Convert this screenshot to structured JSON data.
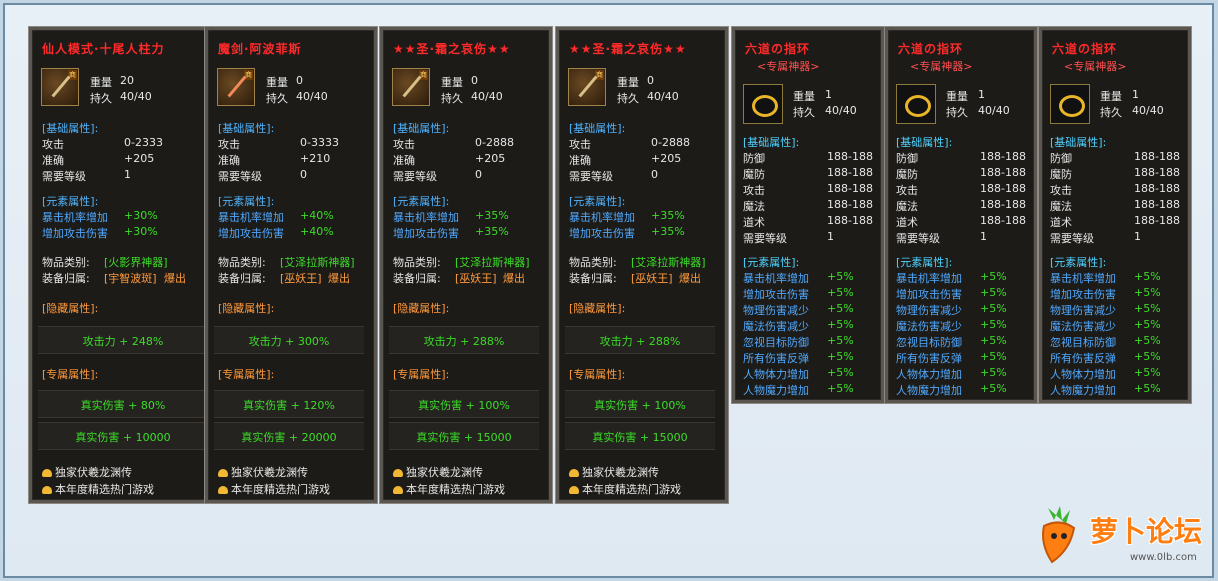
{
  "cards": [
    {
      "title": "仙人模式·十尾人柱力",
      "weight_label": "重量",
      "weight": "20",
      "dur_label": "持久",
      "dur": "40/40",
      "base_header": "[基础属性]:",
      "base": [
        [
          "攻击",
          "0-2333"
        ],
        [
          "准确",
          "+205"
        ],
        [
          "需要等级",
          "1"
        ]
      ],
      "elem_header": "[元素属性]:",
      "elem": [
        [
          "暴击机率增加",
          "+30%"
        ],
        [
          "增加攻击伤害",
          "+30%"
        ]
      ],
      "cat_label": "物品类别:",
      "cat_value": "[火影界神器]",
      "owner_label": "装备归属:",
      "owner_value": "[宇智波斑]",
      "owner_suffix": "爆出",
      "hidden_header": "[隐藏属性]:",
      "hidden": "攻击力 + 248%",
      "excl_header": "[专属属性]:",
      "excl": [
        "真实伤害 + 80%",
        "真实伤害 + 10000"
      ],
      "promo": [
        "独家伏羲龙渊传",
        "本年度精选热门游戏"
      ]
    },
    {
      "title": "魔剑·阿波菲斯",
      "weight_label": "重量",
      "weight": "0",
      "dur_label": "持久",
      "dur": "40/40",
      "base_header": "[基础属性]:",
      "base": [
        [
          "攻击",
          "0-3333"
        ],
        [
          "准确",
          "+210"
        ],
        [
          "需要等级",
          "0"
        ]
      ],
      "elem_header": "[元素属性]:",
      "elem": [
        [
          "暴击机率增加",
          "+40%"
        ],
        [
          "增加攻击伤害",
          "+40%"
        ]
      ],
      "cat_label": "物品类别:",
      "cat_value": "[艾泽拉斯神器]",
      "owner_label": "装备归属:",
      "owner_value": "[巫妖王]",
      "owner_suffix": "爆出",
      "hidden_header": "[隐藏属性]:",
      "hidden": "攻击力 + 300%",
      "excl_header": "[专属属性]:",
      "excl": [
        "真实伤害 + 120%",
        "真实伤害 + 20000"
      ],
      "promo": [
        "独家伏羲龙渊传",
        "本年度精选热门游戏"
      ]
    },
    {
      "title": "★★圣·霜之哀伤★★",
      "weight_label": "重量",
      "weight": "0",
      "dur_label": "持久",
      "dur": "40/40",
      "base_header": "[基础属性]:",
      "base": [
        [
          "攻击",
          "0-2888"
        ],
        [
          "准确",
          "+205"
        ],
        [
          "需要等级",
          "0"
        ]
      ],
      "elem_header": "[元素属性]:",
      "elem": [
        [
          "暴击机率增加",
          "+35%"
        ],
        [
          "增加攻击伤害",
          "+35%"
        ]
      ],
      "cat_label": "物品类别:",
      "cat_value": "[艾泽拉斯神器]",
      "owner_label": "装备归属:",
      "owner_value": "[巫妖王]",
      "owner_suffix": "爆出",
      "hidden_header": "[隐藏属性]:",
      "hidden": "攻击力 + 288%",
      "excl_header": "[专属属性]:",
      "excl": [
        "真实伤害 + 100%",
        "真实伤害 + 15000"
      ],
      "promo": [
        "独家伏羲龙渊传",
        "本年度精选热门游戏"
      ]
    },
    {
      "title": "★★圣·霜之哀伤★★",
      "weight_label": "重量",
      "weight": "0",
      "dur_label": "持久",
      "dur": "40/40",
      "base_header": "[基础属性]:",
      "base": [
        [
          "攻击",
          "0-2888"
        ],
        [
          "准确",
          "+205"
        ],
        [
          "需要等级",
          "0"
        ]
      ],
      "elem_header": "[元素属性]:",
      "elem": [
        [
          "暴击机率增加",
          "+35%"
        ],
        [
          "增加攻击伤害",
          "+35%"
        ]
      ],
      "cat_label": "物品类别:",
      "cat_value": "[艾泽拉斯神器]",
      "owner_label": "装备归属:",
      "owner_value": "[巫妖王]",
      "owner_suffix": "爆出",
      "hidden_header": "[隐藏属性]:",
      "hidden": "攻击力 + 288%",
      "excl_header": "[专属属性]:",
      "excl": [
        "真实伤害 + 100%",
        "真实伤害 + 15000"
      ],
      "promo": [
        "独家伏羲龙渊传",
        "本年度精选热门游戏"
      ]
    }
  ],
  "rings": [
    {
      "title": "六道の指环",
      "subtitle": "<专属神器>",
      "weight_label": "重量",
      "weight": "1",
      "dur_label": "持久",
      "dur": "40/40",
      "base_header": "[基础属性]:",
      "base": [
        [
          "防御",
          "188-188"
        ],
        [
          "魔防",
          "188-188"
        ],
        [
          "攻击",
          "188-188"
        ],
        [
          "魔法",
          "188-188"
        ],
        [
          "道术",
          "188-188"
        ],
        [
          "需要等级",
          "1"
        ]
      ],
      "elem_header": "[元素属性]:",
      "elem": [
        [
          "暴击机率增加",
          "+5%"
        ],
        [
          "增加攻击伤害",
          "+5%"
        ],
        [
          "物理伤害减少",
          "+5%"
        ],
        [
          "魔法伤害减少",
          "+5%"
        ],
        [
          "忽视目标防御",
          "+5%"
        ],
        [
          "所有伤害反弹",
          "+5%"
        ],
        [
          "人物体力增加",
          "+5%"
        ],
        [
          "人物魔力增加",
          "+5%"
        ]
      ]
    },
    {
      "title": "六道の指环",
      "subtitle": "<专属神器>",
      "weight_label": "重量",
      "weight": "1",
      "dur_label": "持久",
      "dur": "40/40",
      "base_header": "[基础属性]:",
      "base": [
        [
          "防御",
          "188-188"
        ],
        [
          "魔防",
          "188-188"
        ],
        [
          "攻击",
          "188-188"
        ],
        [
          "魔法",
          "188-188"
        ],
        [
          "道术",
          "188-188"
        ],
        [
          "需要等级",
          "1"
        ]
      ],
      "elem_header": "[元素属性]:",
      "elem": [
        [
          "暴击机率增加",
          "+5%"
        ],
        [
          "增加攻击伤害",
          "+5%"
        ],
        [
          "物理伤害减少",
          "+5%"
        ],
        [
          "魔法伤害减少",
          "+5%"
        ],
        [
          "忽视目标防御",
          "+5%"
        ],
        [
          "所有伤害反弹",
          "+5%"
        ],
        [
          "人物体力增加",
          "+5%"
        ],
        [
          "人物魔力增加",
          "+5%"
        ]
      ]
    },
    {
      "title": "六道の指环",
      "subtitle": "<专属神器>",
      "weight_label": "重量",
      "weight": "1",
      "dur_label": "持久",
      "dur": "40/40",
      "base_header": "[基础属性]:",
      "base": [
        [
          "防御",
          "188-188"
        ],
        [
          "魔防",
          "188-188"
        ],
        [
          "攻击",
          "188-188"
        ],
        [
          "魔法",
          "188-188"
        ],
        [
          "道术",
          "188-188"
        ],
        [
          "需要等级",
          "1"
        ]
      ],
      "elem_header": "[元素属性]:",
      "elem": [
        [
          "暴击机率增加",
          "+5%"
        ],
        [
          "增加攻击伤害",
          "+5%"
        ],
        [
          "物理伤害减少",
          "+5%"
        ],
        [
          "魔法伤害减少",
          "+5%"
        ],
        [
          "忽视目标防御",
          "+5%"
        ],
        [
          "所有伤害反弹",
          "+5%"
        ],
        [
          "人物体力增加",
          "+5%"
        ],
        [
          "人物魔力增加",
          "+5%"
        ]
      ]
    }
  ],
  "logo": {
    "text": "萝卜论坛",
    "url": "www.0lb.com"
  }
}
